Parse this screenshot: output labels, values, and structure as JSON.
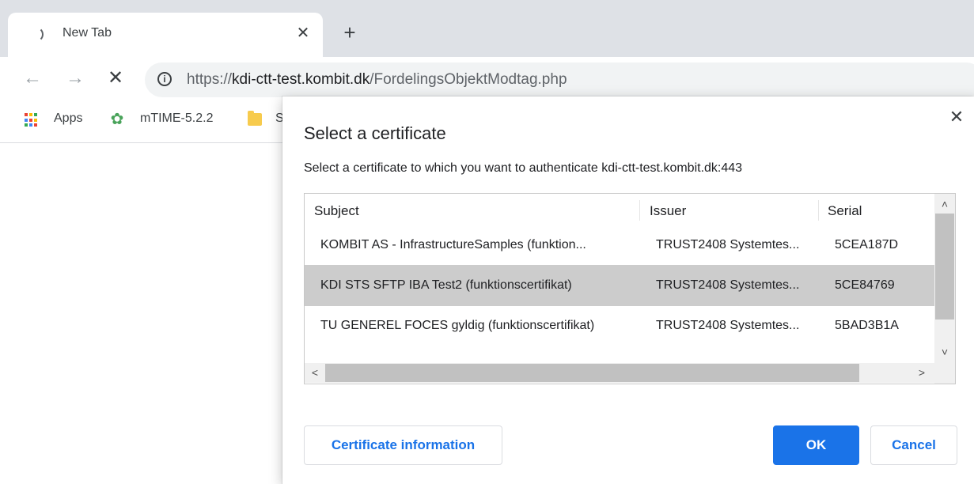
{
  "browser": {
    "tab": {
      "title": "New Tab"
    },
    "url": {
      "scheme": "https://",
      "host": "kdi-ctt-test.kombit.dk",
      "path": "/FordelingsObjektModtag.php"
    },
    "bookmarks": [
      {
        "label": "Apps",
        "icon": "apps-grid-icon"
      },
      {
        "label": "mTIME-5.2.2",
        "icon": "mtime-logo-icon"
      },
      {
        "label": "S",
        "icon": "folder-icon"
      }
    ]
  },
  "dialog": {
    "title": "Select a certificate",
    "description": "Select a certificate to which you want to authenticate kdi-ctt-test.kombit.dk:443",
    "columns": [
      "Subject",
      "Issuer",
      "Serial"
    ],
    "rows": [
      {
        "subject": "KOMBIT AS - InfrastructureSamples (funktion...",
        "issuer": "TRUST2408 Systemtes...",
        "serial": "5CEA187D",
        "selected": false
      },
      {
        "subject": "KDI STS SFTP IBA Test2 (funktionscertifikat)",
        "issuer": "TRUST2408 Systemtes...",
        "serial": "5CE84769",
        "selected": true
      },
      {
        "subject": "TU GENEREL FOCES gyldig (funktionscertifikat)",
        "issuer": "TRUST2408 Systemtes...",
        "serial": "5BAD3B1A",
        "selected": false
      }
    ],
    "buttons": {
      "info": "Certificate information",
      "ok": "OK",
      "cancel": "Cancel"
    }
  },
  "colors": {
    "accent": "#1a73e8",
    "tabstrip": "#dee1e6",
    "selected_row": "#cccccc"
  }
}
